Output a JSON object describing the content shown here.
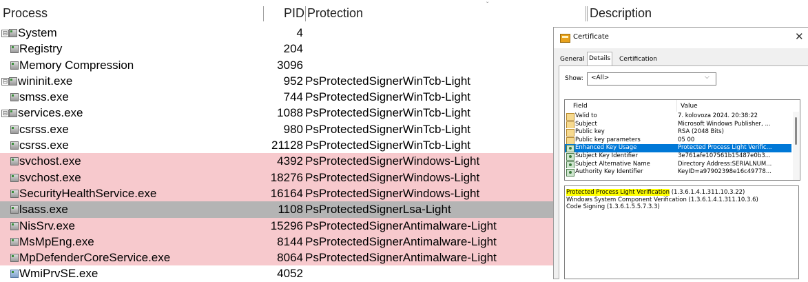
{
  "process_list": {
    "columns": {
      "process": "Process",
      "pid": "PID",
      "protection": "Protection",
      "description": "Description"
    },
    "rows": [
      {
        "name": "System",
        "pid": "4",
        "protection": "",
        "level": 0,
        "expander": "⊟",
        "icon": "process-icon",
        "highlight": "none"
      },
      {
        "name": "Registry",
        "pid": "204",
        "protection": "",
        "level": 1,
        "expander": "",
        "icon": "process-icon",
        "highlight": "none"
      },
      {
        "name": "Memory Compression",
        "pid": "3096",
        "protection": "",
        "level": 1,
        "expander": "",
        "icon": "process-icon",
        "highlight": "none"
      },
      {
        "name": "wininit.exe",
        "pid": "952",
        "protection": "PsProtectedSignerWinTcb-Light",
        "level": 0,
        "expander": "⊟",
        "icon": "process-icon",
        "highlight": "none"
      },
      {
        "name": "smss.exe",
        "pid": "744",
        "protection": "PsProtectedSignerWinTcb-Light",
        "level": 1,
        "expander": "",
        "icon": "process-icon",
        "highlight": "none"
      },
      {
        "name": "services.exe",
        "pid": "1088",
        "protection": "PsProtectedSignerWinTcb-Light",
        "level": 0,
        "expander": "⊟",
        "icon": "process-icon",
        "highlight": "none"
      },
      {
        "name": "csrss.exe",
        "pid": "980",
        "protection": "PsProtectedSignerWinTcb-Light",
        "level": 1,
        "expander": "",
        "icon": "process-icon",
        "highlight": "none"
      },
      {
        "name": "csrss.exe",
        "pid": "21128",
        "protection": "PsProtectedSignerWinTcb-Light",
        "level": 1,
        "expander": "",
        "icon": "process-icon",
        "highlight": "none"
      },
      {
        "name": "svchost.exe",
        "pid": "4392",
        "protection": "PsProtectedSignerWindows-Light",
        "level": 1,
        "expander": "",
        "icon": "process-icon",
        "highlight": "pink"
      },
      {
        "name": "svchost.exe",
        "pid": "18276",
        "protection": "PsProtectedSignerWindows-Light",
        "level": 1,
        "expander": "",
        "icon": "process-icon",
        "highlight": "pink"
      },
      {
        "name": "SecurityHealthService.exe",
        "pid": "16164",
        "protection": "PsProtectedSignerWindows-Light",
        "level": 1,
        "expander": "",
        "icon": "process-icon",
        "highlight": "pink"
      },
      {
        "name": "lsass.exe",
        "pid": "1108",
        "protection": "PsProtectedSignerLsa-Light",
        "level": 1,
        "expander": "",
        "icon": "process-icon",
        "highlight": "grey"
      },
      {
        "name": "NisSrv.exe",
        "pid": "15296",
        "protection": "PsProtectedSignerAntimalware-Light",
        "level": 1,
        "expander": "",
        "icon": "process-icon",
        "highlight": "pink"
      },
      {
        "name": "MsMpEng.exe",
        "pid": "8144",
        "protection": "PsProtectedSignerAntimalware-Light",
        "level": 1,
        "expander": "",
        "icon": "process-icon",
        "highlight": "pink"
      },
      {
        "name": "MpDefenderCoreService.exe",
        "pid": "8064",
        "protection": "PsProtectedSignerAntimalware-Light",
        "level": 1,
        "expander": "",
        "icon": "process-icon",
        "highlight": "pink"
      },
      {
        "name": "WmiPrvSE.exe",
        "pid": "4052",
        "protection": "",
        "level": 1,
        "expander": "",
        "icon": "wmi-process-icon",
        "highlight": "none"
      }
    ],
    "colors": {
      "highlight_pink": "#f7c9cd",
      "highlight_grey": "#b4b4b4"
    }
  },
  "certificate_dialog": {
    "title": "Certificate",
    "close": "✕",
    "tabs": [
      {
        "label": "General",
        "active": false
      },
      {
        "label": "Details",
        "active": true
      },
      {
        "label": "Certification Path",
        "active": false
      }
    ],
    "show_label": "Show:",
    "show_value": "<All>",
    "field_header": "Field",
    "value_header": "Value",
    "fields": [
      {
        "field": "Valid to",
        "value": "7. kolovoza 2024. 20:38:22",
        "icon": "property-icon",
        "selected": false
      },
      {
        "field": "Subject",
        "value": "Microsoft Windows Publisher, ...",
        "icon": "property-icon",
        "selected": false
      },
      {
        "field": "Public key",
        "value": "RSA (2048 Bits)",
        "icon": "property-icon",
        "selected": false
      },
      {
        "field": "Public key parameters",
        "value": "05 00",
        "icon": "property-icon",
        "selected": false
      },
      {
        "field": "Enhanced Key Usage",
        "value": "Protected Process Light Verific...",
        "icon": "extension-icon",
        "selected": true
      },
      {
        "field": "Subject Key Identifier",
        "value": "3e761afe107561b15487e0b3...",
        "icon": "extension-icon",
        "selected": false
      },
      {
        "field": "Subject Alternative Name",
        "value": "Directory Address:SERIALNUM...",
        "icon": "extension-icon",
        "selected": false
      },
      {
        "field": "Authority Key Identifier",
        "value": "KeyID=a97902398e16c49778...",
        "icon": "extension-icon",
        "selected": false
      }
    ],
    "detail_lines": [
      {
        "highlight": "Protected Process Light Verification",
        "rest": " (1.3.6.1.4.1.311.10.3.22)"
      },
      {
        "highlight": "",
        "rest": "Windows System Component Verification (1.3.6.1.4.1.311.10.3.6)"
      },
      {
        "highlight": "",
        "rest": "Code Signing (1.3.6.1.5.5.7.3.3)"
      }
    ],
    "colors": {
      "selection": "#0078d7",
      "text_highlight": "#ffff00"
    }
  }
}
